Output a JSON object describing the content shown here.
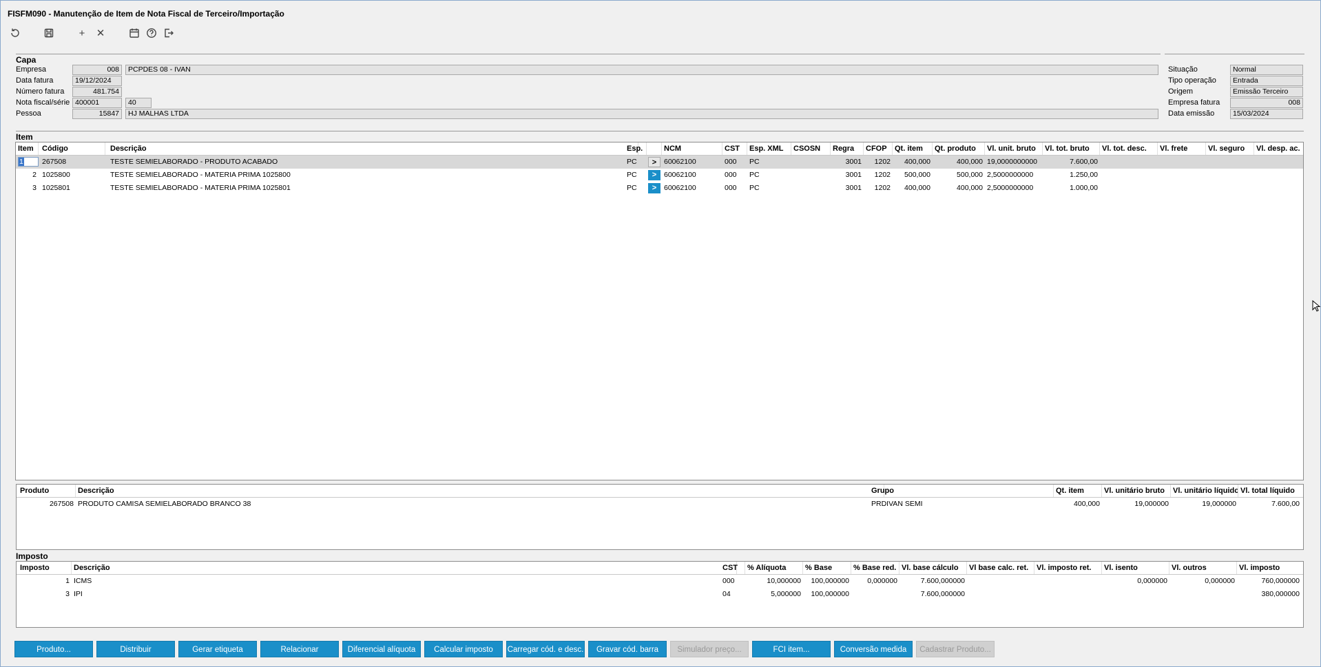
{
  "window": {
    "title": "FISFM090 - Manutenção de Item de Nota Fiscal de Terceiro/Importação"
  },
  "toolbar": {
    "icons": [
      "refresh-icon",
      "save-icon",
      "add-icon",
      "delete-icon",
      "calendar-icon",
      "help-icon",
      "exit-icon"
    ],
    "add_glyph": "+",
    "delete_glyph": "✕"
  },
  "capa": {
    "title": "Capa",
    "empresa_label": "Empresa",
    "empresa_code": "008",
    "empresa_name": "PCPDES 08 - IVAN",
    "data_fatura_label": "Data fatura",
    "data_fatura": "19/12/2024",
    "numero_fatura_label": "Número fatura",
    "numero_fatura": "481.754",
    "nota_label": "Nota fiscal/série",
    "nota": "400001",
    "serie": "40",
    "pessoa_label": "Pessoa",
    "pessoa_code": "15847",
    "pessoa_name": "HJ MALHAS LTDA",
    "situacao_label": "Situação",
    "situacao": "Normal",
    "tipo_op_label": "Tipo operação",
    "tipo_op": "Entrada",
    "origem_label": "Origem",
    "origem": "Emissão Terceiro",
    "empresa_fatura_label": "Empresa fatura",
    "empresa_fatura": "008",
    "data_emissao_label": "Data emissão",
    "data_emissao": "15/03/2024"
  },
  "item": {
    "title": "Item",
    "columns": [
      "Item",
      "Código",
      "Descrição",
      "Esp.",
      "",
      "NCM",
      "CST",
      "Esp. XML",
      "CSOSN",
      "Regra",
      "CFOP",
      "Qt. item",
      "Qt. produto",
      "Vl. unit. bruto",
      "Vl. tot. bruto",
      "Vl. tot. desc.",
      "Vl. frete",
      "Vl. seguro",
      "Vl. desp. ac."
    ],
    "arrow_glyph": ">",
    "rows": [
      {
        "item": "1",
        "codigo": "267508",
        "descricao": "TESTE SEMIELABORADO - PRODUTO ACABADO",
        "esp": "PC",
        "ncm": "60062100",
        "cst": "000",
        "esp_xml": "PC",
        "csosn": "",
        "regra": "3001",
        "cfop": "1202",
        "qt_item": "400,000",
        "qt_produto": "400,000",
        "vl_unit": "19,0000000000",
        "vl_tot": "7.600,00"
      },
      {
        "item": "2",
        "codigo": "1025800",
        "descricao": "TESTE SEMIELABORADO - MATERIA PRIMA 1025800",
        "esp": "PC",
        "ncm": "60062100",
        "cst": "000",
        "esp_xml": "PC",
        "csosn": "",
        "regra": "3001",
        "cfop": "1202",
        "qt_item": "500,000",
        "qt_produto": "500,000",
        "vl_unit": "2,5000000000",
        "vl_tot": "1.250,00"
      },
      {
        "item": "3",
        "codigo": "1025801",
        "descricao": "TESTE SEMIELABORADO - MATERIA PRIMA 1025801",
        "esp": "PC",
        "ncm": "60062100",
        "cst": "000",
        "esp_xml": "PC",
        "csosn": "",
        "regra": "3001",
        "cfop": "1202",
        "qt_item": "400,000",
        "qt_produto": "400,000",
        "vl_unit": "2,5000000000",
        "vl_tot": "1.000,00"
      }
    ]
  },
  "produto": {
    "columns": [
      "Produto",
      "Descrição",
      "Grupo",
      "Qt. item",
      "Vl. unitário bruto",
      "Vl. unitário líquido",
      "Vl. total líquido"
    ],
    "rows": [
      {
        "produto": "267508",
        "descricao": "PRODUTO CAMISA SEMIELABORADO BRANCO 38",
        "grupo": "PRDIVAN SEMI",
        "qt_item": "400,000",
        "vl_unit_bruto": "19,000000",
        "vl_unit_liq": "19,000000",
        "vl_total_liq": "7.600,00"
      }
    ]
  },
  "imposto": {
    "title": "Imposto",
    "columns": [
      "Imposto",
      "Descrição",
      "CST",
      "% Alíquota",
      "% Base",
      "% Base red.",
      "Vl. base cálculo",
      "Vl base calc. ret.",
      "Vl. imposto ret.",
      "Vl. isento",
      "Vl. outros",
      "Vl. imposto"
    ],
    "rows": [
      {
        "imposto": "1",
        "descricao": "ICMS",
        "cst": "000",
        "aliquota": "10,000000",
        "base": "100,000000",
        "base_red": "0,000000",
        "vl_base": "7.600,000000",
        "vl_base_ret": "",
        "vl_imp_ret": "",
        "isento": "0,000000",
        "outros": "0,000000",
        "vl_imposto": "760,000000"
      },
      {
        "imposto": "3",
        "descricao": "IPI",
        "cst": "04",
        "aliquota": "5,000000",
        "base": "100,000000",
        "base_red": "",
        "vl_base": "7.600,000000",
        "vl_base_ret": "",
        "vl_imp_ret": "",
        "isento": "",
        "outros": "",
        "vl_imposto": "380,000000"
      }
    ]
  },
  "buttons": [
    "Produto...",
    "Distribuir",
    "Gerar etiqueta",
    "Relacionar",
    "Diferencial alíquota",
    "Calcular imposto",
    "Carregar cód. e desc.",
    "Gravar cód. barra",
    "Simulador preço...",
    "FCI item...",
    "Conversão medida",
    "Cadastrar Produto..."
  ],
  "colors": {
    "button": "#1a8fc9",
    "button_disabled": "#d0d0d0",
    "selection": "#3a76c9"
  }
}
